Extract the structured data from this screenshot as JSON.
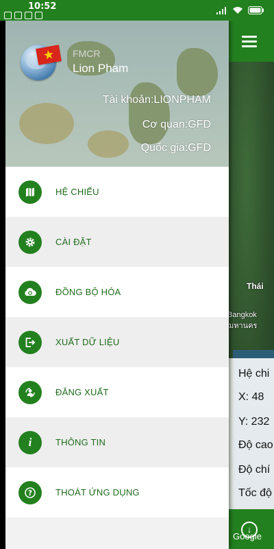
{
  "status_bar": {
    "time": "10:52"
  },
  "drawer": {
    "header": {
      "app_name": "FMCR",
      "user_name": "Lion Pham",
      "account": "Tài khoản:LIONPHAM",
      "agency": "Cơ quan:GFD",
      "country": "Quốc gia:GFD"
    },
    "menu": [
      {
        "label": "HỆ CHIẾU",
        "icon": "map-icon"
      },
      {
        "label": "CÀI ĐẶT",
        "icon": "gear-icon"
      },
      {
        "label": "ĐỒNG BỘ HÓA",
        "icon": "cloud-sync-icon"
      },
      {
        "label": "XUẤT DỮ LIỆU",
        "icon": "export-icon"
      },
      {
        "label": "ĐĂNG XUẤT",
        "icon": "logout-user-icon"
      },
      {
        "label": "THÔNG TIN",
        "icon": "info-icon"
      },
      {
        "label": "THOÁT ỨNG DỤNG",
        "icon": "help-icon"
      }
    ]
  },
  "map": {
    "labels": {
      "thai": "Thái",
      "bangkok": "Bangkok",
      "bangkok_local": "มหานคร",
      "paren": ")"
    },
    "info_panel": {
      "line1": "Hệ chi",
      "line2": "X: 48",
      "line3": "Y: 232",
      "line4": "Độ cao",
      "line5": "Độ chí",
      "line6": "Tốc độ"
    },
    "google": "Google"
  },
  "colors": {
    "primary_green": "#23801f",
    "label_green": "#1e6b1a"
  }
}
